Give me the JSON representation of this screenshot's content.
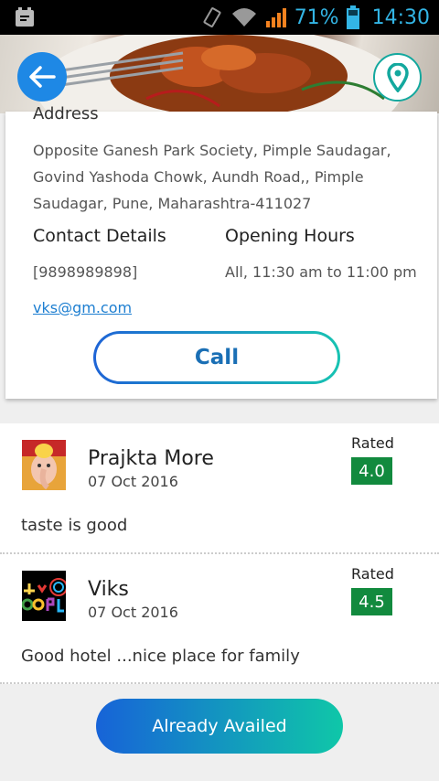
{
  "status_bar": {
    "battery_percent": "71%",
    "time": "14:30",
    "icons": [
      "app-notification-icon",
      "vibrate-icon",
      "wifi-icon",
      "signal-icon",
      "battery-icon"
    ]
  },
  "header": {
    "back_icon": "arrow-left-icon",
    "location_icon": "map-pin-icon"
  },
  "info": {
    "address_title": "Address",
    "address": "Opposite Ganesh Park Society, Pimple Saudagar, Govind Yashoda Chowk, Aundh Road,, Pimple Saudagar, Pune, Maharashtra-411027",
    "contact_title": "Contact Details",
    "phone": "[9898989898]",
    "email": "vks@gm.com",
    "hours_title": "Opening Hours",
    "hours": "All, 11:30 am to 11:00 pm",
    "call_label": "Call"
  },
  "reviews": [
    {
      "name": "Prajkta More",
      "date": "07 Oct 2016",
      "rated_label": "Rated",
      "rating": "4.0",
      "comment": "taste is good"
    },
    {
      "name": "Viks",
      "date": "07 Oct 2016",
      "rated_label": "Rated",
      "rating": "4.5",
      "comment": "Good hotel ...nice place for family"
    }
  ],
  "action": {
    "label": "Already Availed"
  },
  "colors": {
    "accent_blue": "#1e88e5",
    "accent_teal": "#13a89e",
    "rating_green": "#128a3e",
    "status_blue": "#33b5e5"
  }
}
